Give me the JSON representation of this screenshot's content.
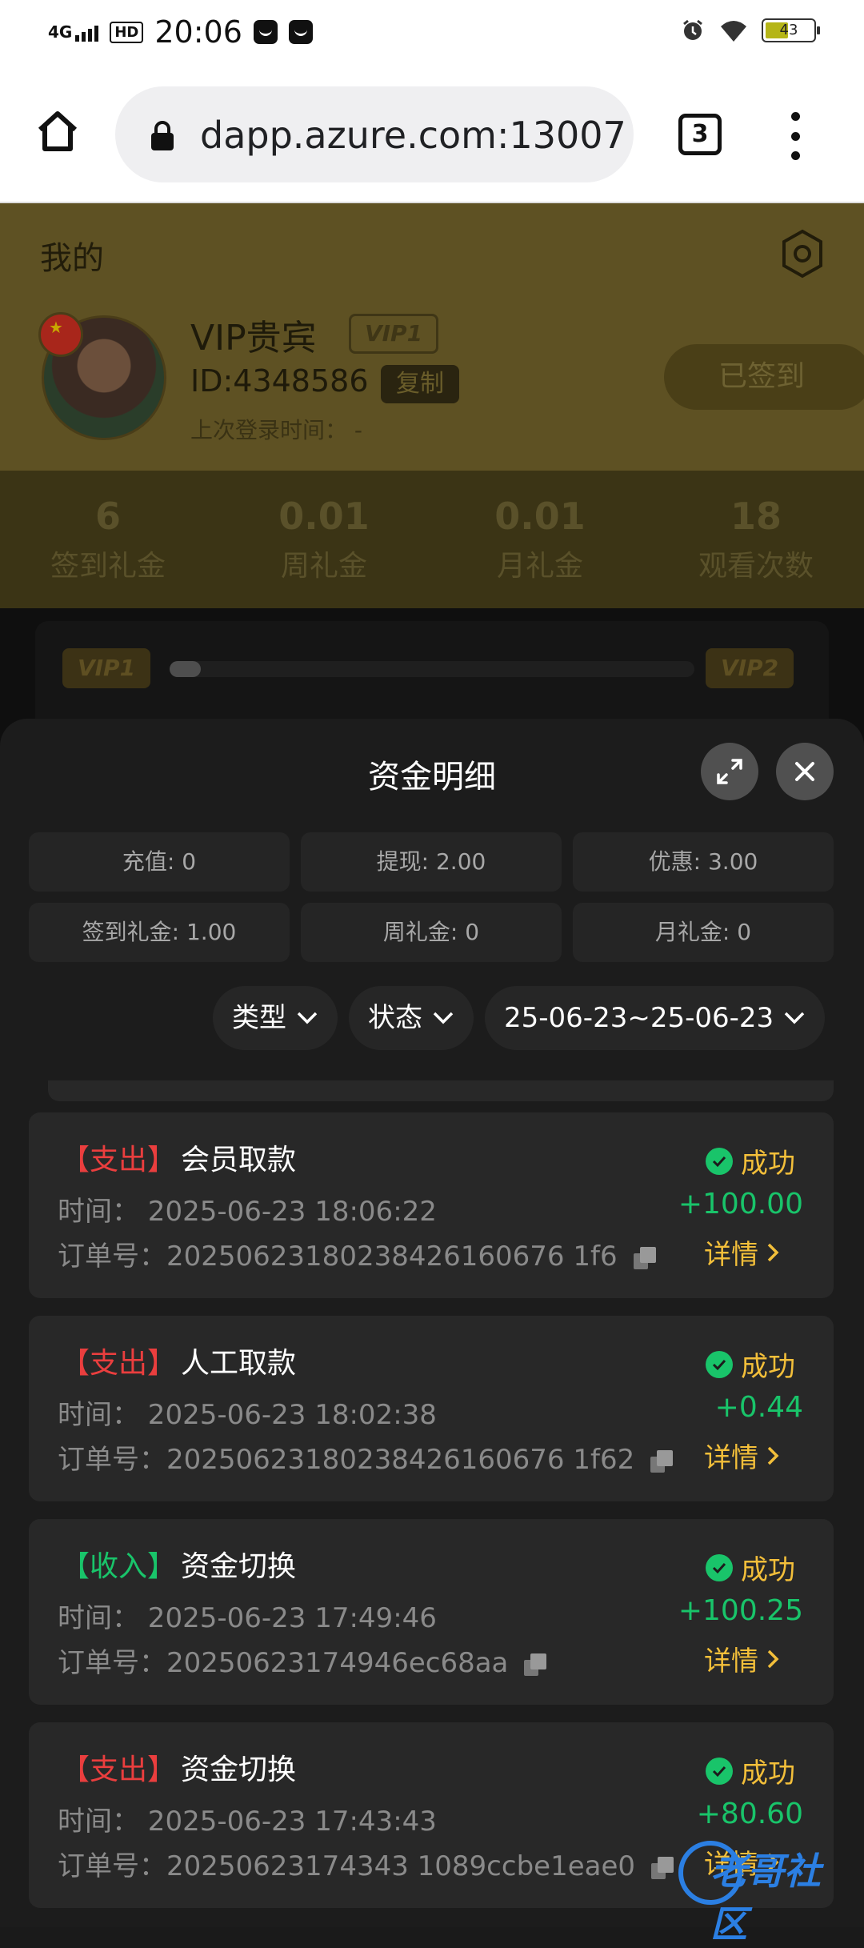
{
  "status_bar": {
    "network": "4G",
    "hd": "HD",
    "time": "20:06",
    "battery": "43"
  },
  "browser": {
    "url": "dapp.azure.com:13007",
    "tab_count": "3"
  },
  "profile": {
    "title": "我的",
    "name": "VIP贵宾",
    "vip_badge": "VIP1",
    "user_id": "ID:4348586",
    "copy_label": "复制",
    "last_login": "上次登录时间： -",
    "signed_label": "已签到"
  },
  "stats": [
    {
      "value": "6",
      "label": "签到礼金"
    },
    {
      "value": "0.01",
      "label": "周礼金"
    },
    {
      "value": "0.01",
      "label": "月礼金"
    },
    {
      "value": "18",
      "label": "观看次数"
    }
  ],
  "vip_progress": {
    "from": "VIP1",
    "to": "VIP2",
    "progress_percent": 4
  },
  "sheet": {
    "title": "资金明细",
    "summary_row1": [
      "充值: 0",
      "提现: 2.00",
      "优惠: 3.00"
    ],
    "summary_row2": [
      "签到礼金: 1.00",
      "周礼金: 0",
      "月礼金: 0"
    ],
    "filters": {
      "type": "类型",
      "status": "状态",
      "date_range": "25-06-23~25-06-23"
    },
    "records": [
      {
        "tag": "【支出】",
        "direction": "out",
        "name": "会员取款",
        "time": "时间：  2025-06-23 18:06:22",
        "order": "订单号：20250623180238426160676 1f6",
        "status": "成功",
        "amount": "+100.00",
        "detail": "详情"
      },
      {
        "tag": "【支出】",
        "direction": "out",
        "name": "人工取款",
        "time": "时间：  2025-06-23 18:02:38",
        "order": "订单号：20250623180238426160676 1f62",
        "status": "成功",
        "amount": "+0.44",
        "detail": "详情"
      },
      {
        "tag": "【收入】",
        "direction": "in",
        "name": "资金切换",
        "time": "时间：  2025-06-23 17:49:46",
        "order": "订单号：20250623174946ec68aa",
        "status": "成功",
        "amount": "+100.25",
        "detail": "详情"
      },
      {
        "tag": "【支出】",
        "direction": "out",
        "name": "资金切换",
        "time": "时间：  2025-06-23 17:43:43",
        "order": "订单号：20250623174343 1089ccbe1eae0",
        "status": "成功",
        "amount": "+80.60",
        "detail": "详情"
      }
    ]
  },
  "watermark": "老哥社区",
  "colors": {
    "success_green": "#19c46a",
    "expense_red": "#ea3e3e",
    "gold": "#f3bf3a"
  }
}
